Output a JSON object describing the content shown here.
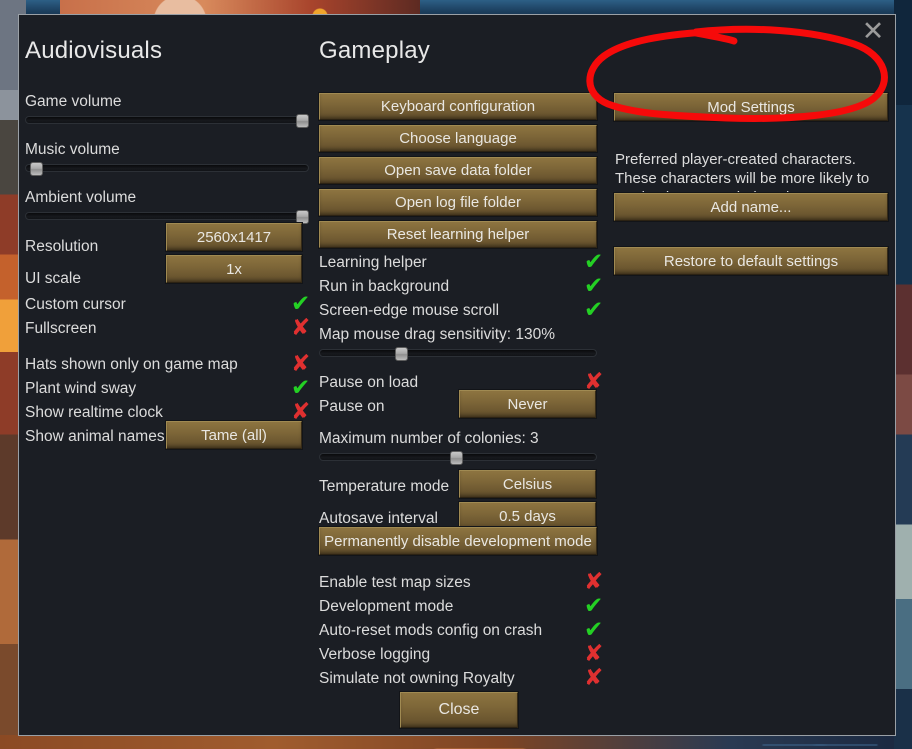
{
  "dialog": {
    "close_icon": "✕"
  },
  "audiovisuals": {
    "title": "Audiovisuals",
    "sliders": [
      {
        "label": "Game volume",
        "value": 97
      },
      {
        "label": "Music volume",
        "value": 2
      },
      {
        "label": "Ambient volume",
        "value": 97
      }
    ],
    "dropdowns": [
      {
        "label": "Resolution",
        "value": "2560x1417"
      },
      {
        "label": "UI scale",
        "value": "1x"
      }
    ],
    "toggles_group1": [
      {
        "label": "Custom cursor",
        "state": "on",
        "glyph": "✔"
      },
      {
        "label": "Fullscreen",
        "state": "off",
        "glyph": "✘"
      }
    ],
    "toggles_group2": [
      {
        "label": "Hats shown only on game map",
        "state": "off",
        "glyph": "✘"
      },
      {
        "label": "Plant wind sway",
        "state": "on",
        "glyph": "✔"
      },
      {
        "label": "Show realtime clock",
        "state": "off",
        "glyph": "✘"
      }
    ],
    "animal_names": {
      "label": "Show animal names",
      "value": "Tame (all)"
    }
  },
  "gameplay": {
    "title": "Gameplay",
    "buttons": [
      "Keyboard configuration",
      "Choose language",
      "Open save data folder",
      "Open log file folder",
      "Reset learning helper"
    ],
    "toggles_group1": [
      {
        "label": "Learning helper",
        "state": "on",
        "glyph": "✔"
      },
      {
        "label": "Run in background",
        "state": "on",
        "glyph": "✔"
      },
      {
        "label": "Screen-edge mouse scroll",
        "state": "on",
        "glyph": "✔"
      }
    ],
    "drag_sensitivity": {
      "label": "Map mouse drag sensitivity: 130%",
      "value": 29
    },
    "pause_on_load": {
      "label": "Pause on load",
      "state": "off",
      "glyph": "✘"
    },
    "pause_on": {
      "label": "Pause on",
      "value": "Never"
    },
    "max_colonies": {
      "label": "Maximum number of colonies: 3",
      "value": 49
    },
    "temperature_mode": {
      "label": "Temperature mode",
      "value": "Celsius"
    },
    "autosave_interval": {
      "label": "Autosave interval",
      "value": "0.5 days"
    },
    "disable_dev_mode_button": "Permanently disable development mode",
    "toggles_group2": [
      {
        "label": "Enable test map sizes",
        "state": "off",
        "glyph": "✘"
      },
      {
        "label": "Development mode",
        "state": "on",
        "glyph": "✔"
      },
      {
        "label": "Auto-reset mods config on crash",
        "state": "on",
        "glyph": "✔"
      },
      {
        "label": "Verbose logging",
        "state": "off",
        "glyph": "✘"
      },
      {
        "label": "Simulate not owning Royalty",
        "state": "off",
        "glyph": "✘"
      }
    ]
  },
  "mods": {
    "mod_settings_button": "Mod Settings",
    "preferred_chars_text": "Preferred player-created characters. These characters will be more likely to randomly appear during play:",
    "add_name_button": "Add name...",
    "restore_defaults_button": "Restore to default settings"
  },
  "footer": {
    "close_button": "Close"
  },
  "colors": {
    "accent_button": "#7d6638",
    "check_green": "#24d024",
    "cross_red": "#e03030",
    "annotation_red": "#f60a0a",
    "dialog_bg": "#1b1e24"
  }
}
